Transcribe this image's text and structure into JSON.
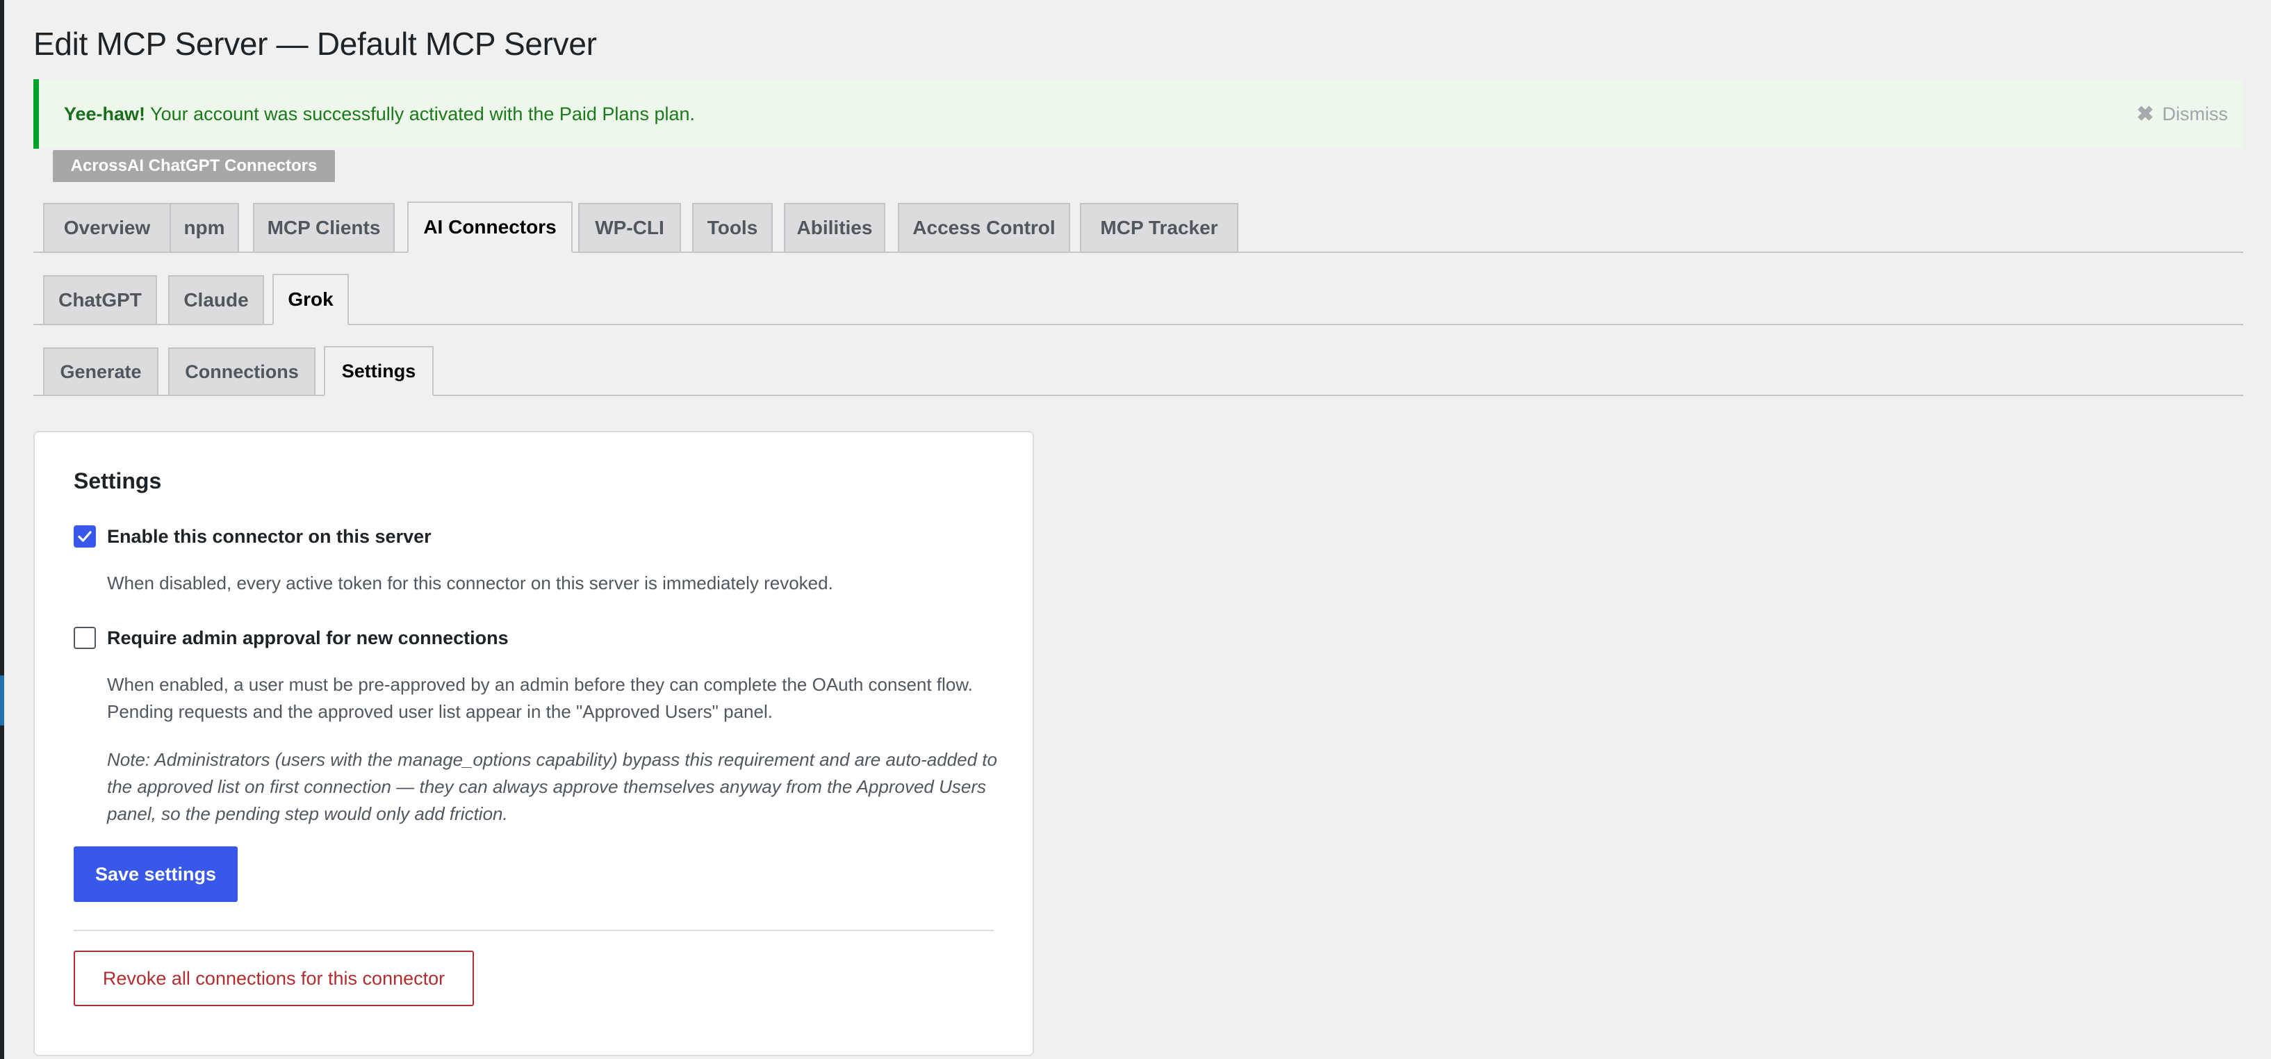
{
  "page": {
    "title": "Edit MCP Server — Default MCP Server"
  },
  "notice": {
    "strong": "Yee-haw!",
    "message": " Your account was successfully activated with the Paid Plans plan.",
    "dismiss_icon": "close-icon",
    "dismiss_label": "Dismiss"
  },
  "plugin_badge": "AcrossAI ChatGPT Connectors",
  "main_tabs": [
    "Overview",
    "npm",
    "MCP Clients",
    "AI Connectors",
    "WP-CLI",
    "Tools",
    "Abilities",
    "Access Control",
    "MCP Tracker"
  ],
  "main_tabs_active": "AI Connectors",
  "connector_tabs": [
    "ChatGPT",
    "Claude",
    "Grok"
  ],
  "connector_tabs_active": "Grok",
  "sub_tabs": [
    "Generate",
    "Connections",
    "Settings"
  ],
  "sub_tabs_active": "Settings",
  "settings": {
    "title": "Settings",
    "enable": {
      "label": "Enable this connector on this server",
      "checked": true,
      "description": "When disabled, every active token for this connector on this server is immediately revoked."
    },
    "approval": {
      "label": "Require admin approval for new connections",
      "checked": false,
      "description": "When enabled, a user must be pre-approved by an admin before they can complete the OAuth consent flow. Pending requests and the approved user list appear in the \"Approved Users\" panel.",
      "note": "Note: Administrators (users with the manage_options capability) bypass this requirement and are auto-added to the approved list on first connection — they can always approve themselves anyway from the Approved Users panel, so the pending step would only add friction."
    },
    "save_label": "Save settings",
    "revoke_label": "Revoke all connections for this connector"
  },
  "colors": {
    "primary": "#3858e9",
    "success": "#00a32a",
    "danger": "#b32d2e"
  }
}
